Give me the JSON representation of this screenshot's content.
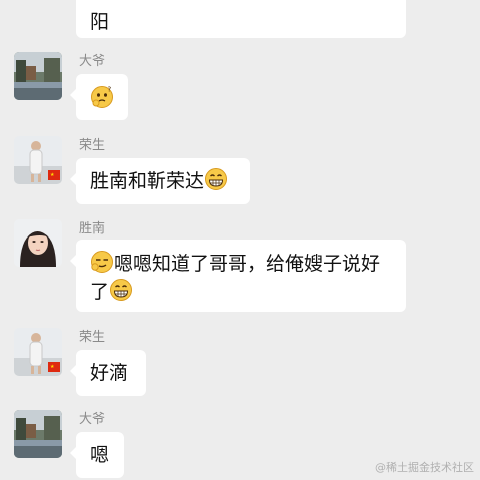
{
  "messages": [
    {
      "type": "text",
      "text": "阳"
    },
    {
      "sender": "大爷",
      "type": "emoji",
      "emoji": "thinking-face-icon"
    },
    {
      "sender": "荣生",
      "text": "胜南和靳荣达",
      "emoji_after": "grinning-face-icon"
    },
    {
      "sender": "胜南",
      "emoji_before": "smirk-face-icon",
      "line1": "嗯嗯知道了哥哥，给俺嫂子说好",
      "line2": "了",
      "emoji_after": "grinning-face-icon"
    },
    {
      "sender": "荣生",
      "text": "好滴"
    },
    {
      "sender": "大爷",
      "text": "嗯"
    }
  ],
  "watermark": "@稀土掘金技术社区",
  "colors": {
    "background": "#ededed",
    "bubble": "#ffffff",
    "name": "#8a8a8a"
  }
}
